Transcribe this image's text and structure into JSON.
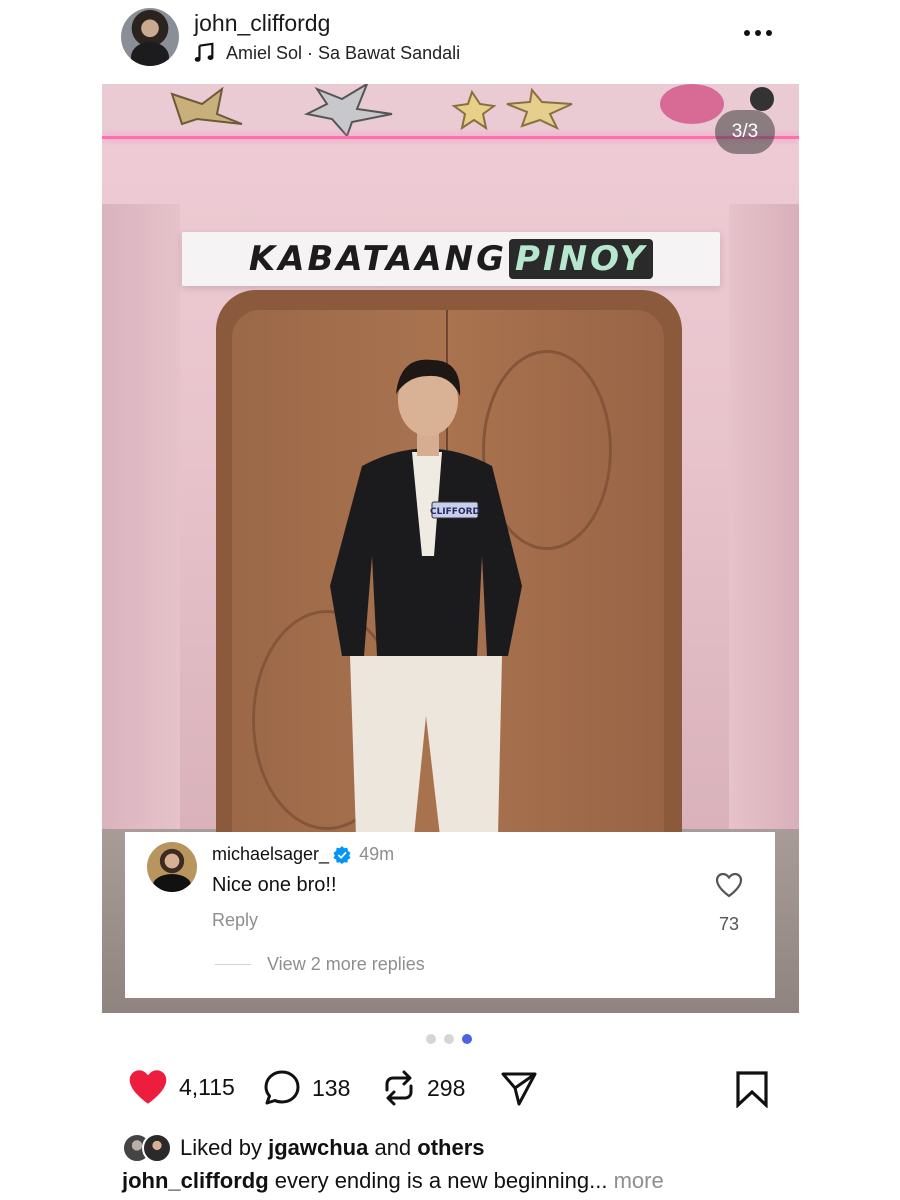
{
  "post": {
    "username": "john_cliffordg",
    "music": "Amiel Sol · Sa Bawat Sandali",
    "carousel_indicator": "3/3",
    "photo_sign_main": "KABATAANG",
    "photo_sign_highlight": "PINOY",
    "jacket_tag": "CLIFFORD"
  },
  "comment": {
    "username": "michaelsager_",
    "time": "49m",
    "text": "Nice one bro!!",
    "reply_label": "Reply",
    "likes": "73",
    "view_replies": "View 2 more replies"
  },
  "pagination": {
    "total": 3,
    "active_index": 2
  },
  "actions": {
    "likes": "4,115",
    "comments": "138",
    "reposts": "298"
  },
  "liked_by": {
    "prefix": "Liked by",
    "user": "jgawchua",
    "middle": "and",
    "others": "others"
  },
  "caption": {
    "username": "john_cliffordg",
    "text": "every ending is a new beginning...",
    "more_label": "more"
  },
  "colors": {
    "heart": "#ee1d3d",
    "accent_dot": "#4a63e0",
    "verified": "#0095f6",
    "secondary_text": "#8e8e8e",
    "neon": "#ff6fb0"
  },
  "icons": [
    "music-note-icon",
    "more-icon",
    "heart-icon",
    "comment-icon",
    "repost-icon",
    "share-icon",
    "bookmark-icon",
    "verified-icon"
  ]
}
